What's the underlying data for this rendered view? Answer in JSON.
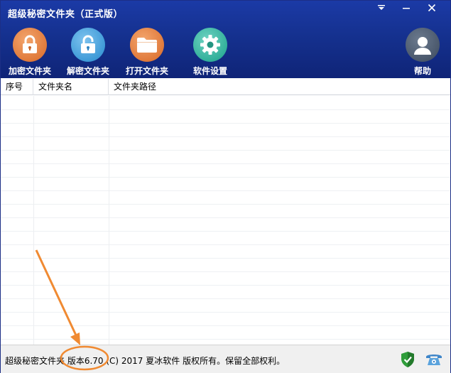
{
  "window": {
    "title": "超级秘密文件夹（正式版）"
  },
  "toolbar": {
    "items": [
      {
        "label": "加密文件夹",
        "icon": "lock-icon",
        "color": "#e07a3b"
      },
      {
        "label": "解密文件夹",
        "icon": "unlock-icon",
        "color": "#3f9bd8"
      },
      {
        "label": "打开文件夹",
        "icon": "folder-icon",
        "color": "#e07a3b"
      },
      {
        "label": "软件设置",
        "icon": "gear-icon",
        "color": "#32b09b"
      }
    ],
    "help": {
      "label": "帮助",
      "icon": "user-avatar-icon",
      "color": "#4a586c"
    }
  },
  "table": {
    "columns": [
      "序号",
      "文件夹名",
      "文件夹路径"
    ],
    "rows": []
  },
  "statusbar": {
    "text": "超级秘密文件夹 版本6.70 (C) 2017 夏冰软件 版权所有。保留全部权利。",
    "icons": [
      "shield-check-icon",
      "telephone-icon"
    ]
  },
  "annotation": {
    "color": "#f08a32"
  },
  "colors": {
    "header": "#15318f",
    "accent_orange": "#e07a3b"
  }
}
